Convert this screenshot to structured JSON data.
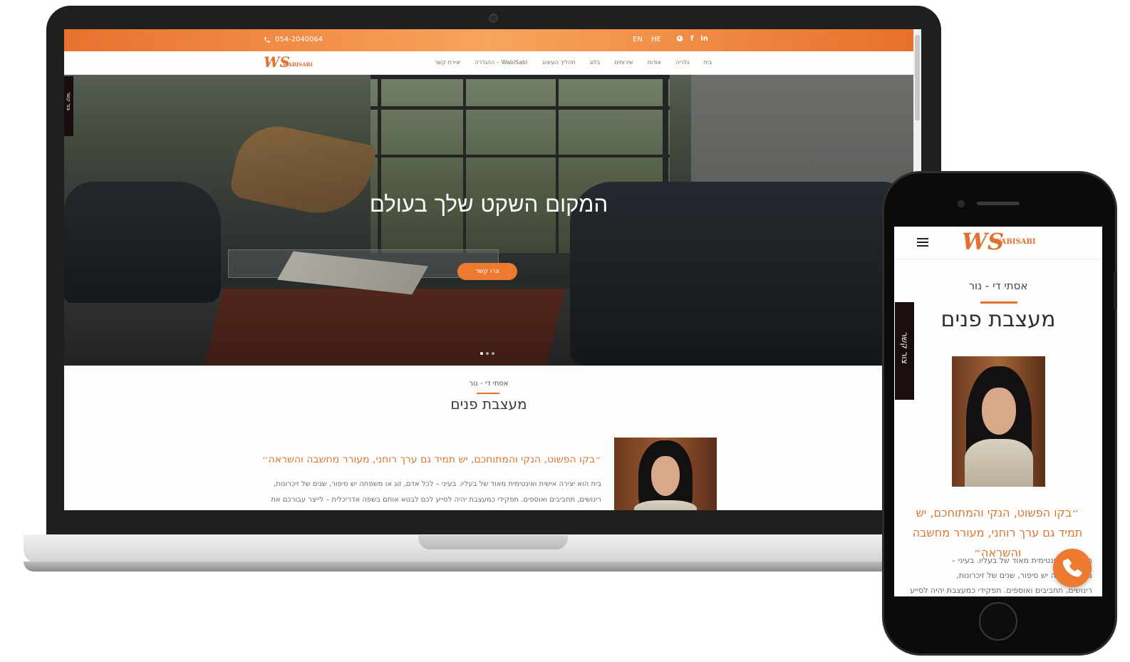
{
  "desktop": {
    "topbar": {
      "phone": "054-2040064",
      "lang_en": "EN",
      "lang_he": "HE",
      "social": [
        "pinterest-icon",
        "facebook-icon",
        "linkedin-icon"
      ]
    },
    "nav": {
      "logo_mark": "WS",
      "logo_word": "WABISABI",
      "items": [
        "בית",
        "גלריה",
        "אודות",
        "שירותים",
        "בלוג",
        "תהליך העיצוב",
        "WabiSabi – ההגדרה",
        "יצירת קשר"
      ]
    },
    "side_tab": "צור קשר",
    "hero": {
      "title": "המקום השקט שלך בעולם",
      "button": "צרו קשר",
      "slides": 3,
      "active_slide": 1
    },
    "intro": {
      "kicker": "אסתי די - נור",
      "heading": "מעצבת פנים",
      "quote": "״בקו הפשוט, הנקי והמתוחכם, יש תמיד גם ערך רוחני, מעורר מחשבה והשראה״",
      "para_line1": "בית הוא יצירה אישית ואינטימית מאוד של בעליו. בעיני – לכל אדם, זוג או משפחה יש סיפור, שנים של זיכרונות,",
      "para_line2": "רינושים, תחביבים ואוספים. תפקידי כמעצבת יהיה לסייע לכם לבטא אותם בשפה אדריכלית – לייצר עבורכם את"
    }
  },
  "mobile": {
    "logo_mark": "WS",
    "logo_word": "WABISABI",
    "side_tab": "צור קשר",
    "kicker": "אסתי די - נור",
    "heading": "מעצבת פנים",
    "quote": "״בקו הפשוט, הנקי והמתוחכם, יש תמיד גם ערך רוחני, מעורר מחשבה והשראה״",
    "para_line1": "ה אישית ואינטימית מאוד של בעליו. בעיני –",
    "para_line2": "ג או משפחה יש סיפור, שנים של זיכרונות,",
    "para_line3": "רינושים, תחביבים ואוספים. תפקידי כמעצבת יהיה לסייע",
    "call_icon": "phone-icon"
  },
  "colors": {
    "accent": "#ec7a31",
    "quote": "#d9773a",
    "dark_tab": "#1a0d0d"
  }
}
